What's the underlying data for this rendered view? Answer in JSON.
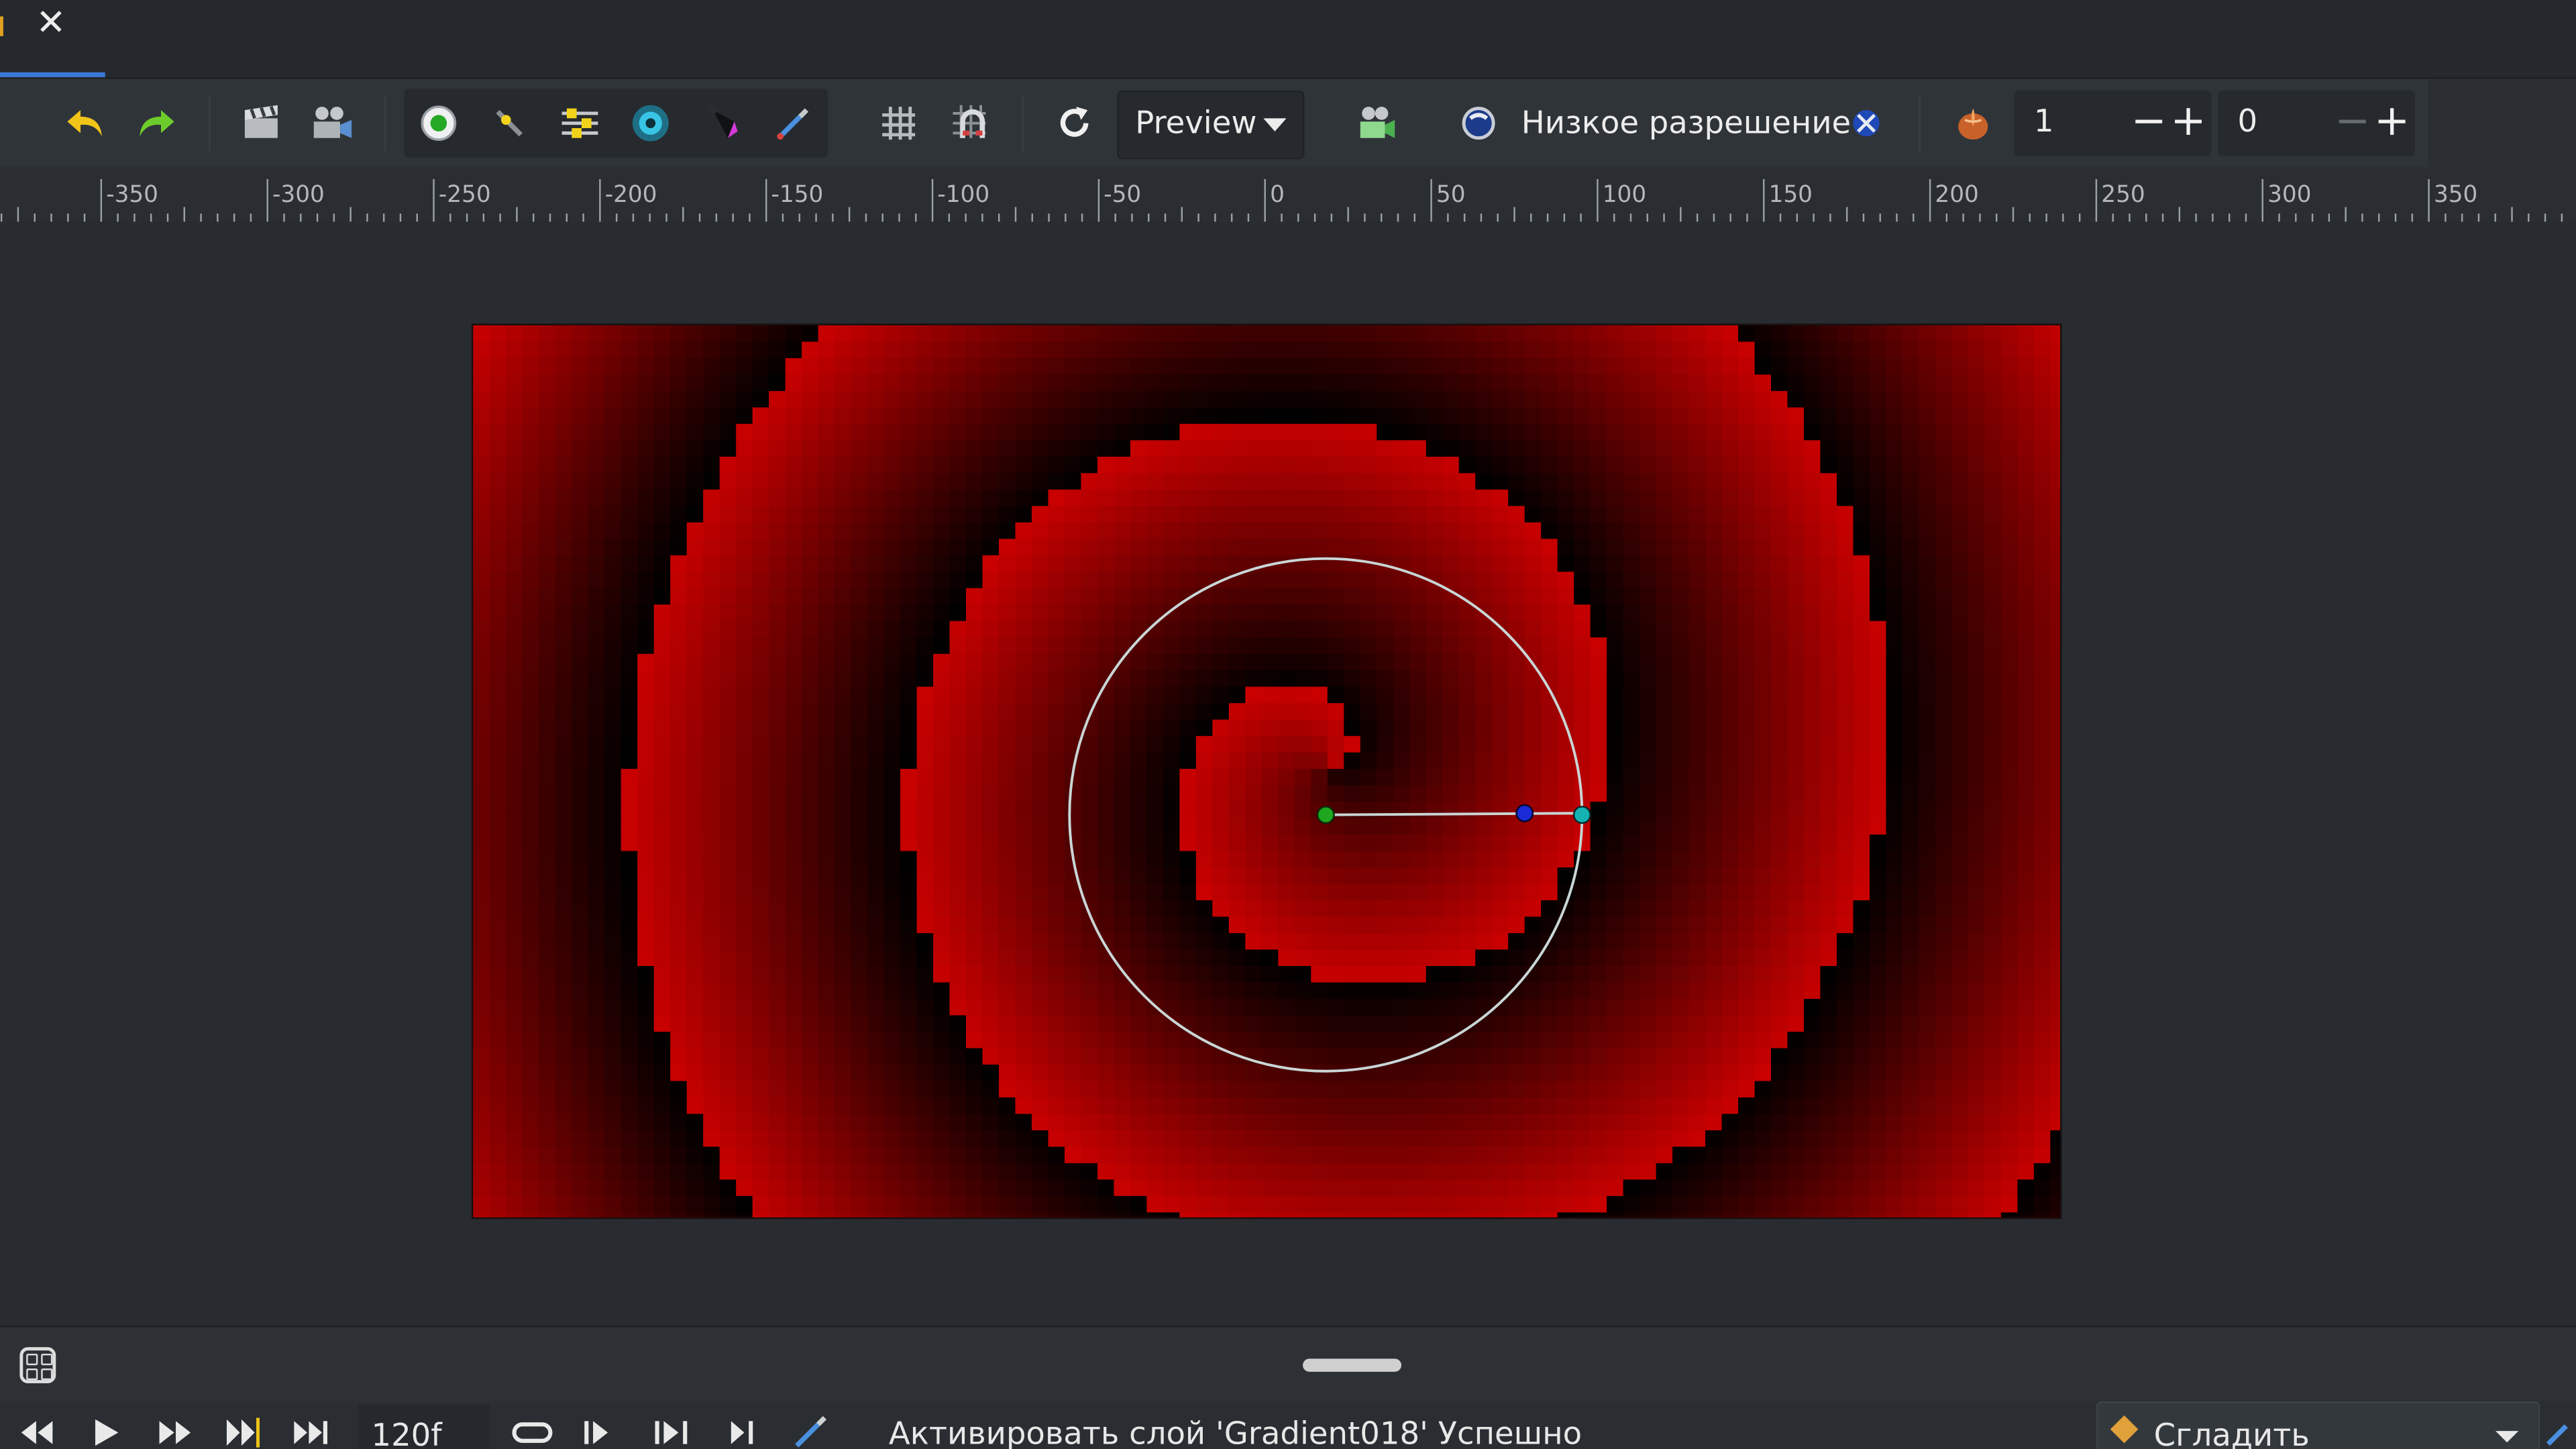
{
  "tab": {
    "close_glyph": "✕"
  },
  "toolbar": {
    "icons": [
      "undo-icon",
      "redo-icon",
      "render-settings-icon",
      "render-icon",
      "onion-skin-toggle-icon",
      "draw-tool-icon",
      "background-rendering-icon",
      "toggle-ducks-icon",
      "toggle-bones-icon",
      "eyedropper-icon",
      "grid-icon",
      "snap-grid-icon",
      "refresh-icon"
    ],
    "preview_label": "Preview",
    "lowres_label": "Низкое разрешение",
    "past_onion": "1",
    "future_onion": "0",
    "minus_glyph": "−",
    "plus_glyph": "+"
  },
  "ruler": {
    "labels": [
      "-350",
      "-300",
      "-250",
      "-200",
      "-150",
      "-100",
      "-50",
      "0",
      "50",
      "100",
      "150",
      "200",
      "250",
      "300",
      "350"
    ]
  },
  "playback": {
    "frame": "120f",
    "status_text": "Активировать слой 'Gradient018' Успешно",
    "interpolation": "Сгладить"
  },
  "colors": {
    "gradient_a": "#c80000",
    "gradient_b": "#000000",
    "duck_origin": "#1fa81f",
    "duck_tangent": "#1a2bd6",
    "duck_radius": "#16b2b2"
  }
}
